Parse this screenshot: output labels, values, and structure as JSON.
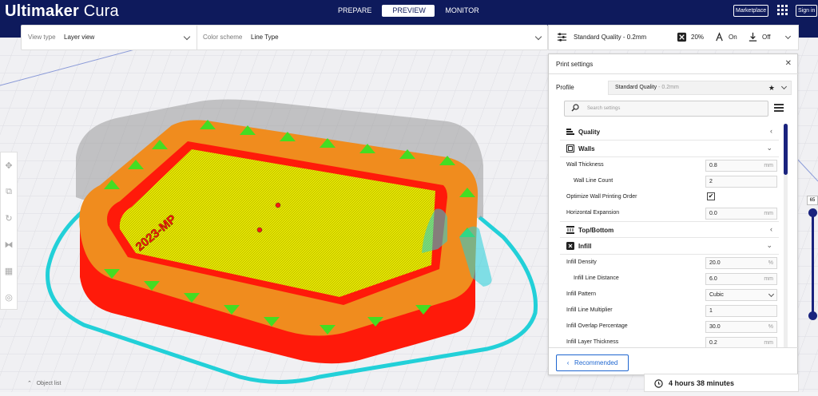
{
  "header": {
    "logo_bold": "Ultimaker",
    "logo_light": "Cura",
    "tabs": [
      {
        "label": "PREPARE"
      },
      {
        "label": "PREVIEW"
      },
      {
        "label": "MONITOR"
      }
    ],
    "marketplace": "Marketplace",
    "signin": "Sign in"
  },
  "toolbar": {
    "view_type_label": "View type",
    "view_type_value": "Layer view",
    "color_scheme_label": "Color scheme",
    "color_scheme_value": "Line Type"
  },
  "quality_bar": {
    "profile": "Standard Quality - 0.2mm",
    "infill": "20%",
    "support": "On",
    "adhesion": "Off"
  },
  "panel": {
    "title": "Print settings",
    "profile_label": "Profile",
    "profile_value": "Standard Quality",
    "profile_sub": " - 0.2mm",
    "search_placeholder": "Search settings",
    "categories": {
      "quality": "Quality",
      "walls": "Walls",
      "topbottom": "Top/Bottom",
      "infill": "Infill"
    },
    "settings": {
      "wall_thickness": {
        "label": "Wall Thickness",
        "value": "0.8",
        "unit": "mm"
      },
      "wall_line_count": {
        "label": "Wall Line Count",
        "value": "2"
      },
      "optimize_wall": {
        "label": "Optimize Wall Printing Order",
        "checked": "✔"
      },
      "horizontal_expansion": {
        "label": "Horizontal Expansion",
        "value": "0.0",
        "unit": "mm"
      },
      "infill_density": {
        "label": "Infill Density",
        "value": "20.0",
        "unit": "%"
      },
      "infill_line_distance": {
        "label": "Infill Line Distance",
        "value": "6.0",
        "unit": "mm"
      },
      "infill_pattern": {
        "label": "Infill Pattern",
        "value": "Cubic"
      },
      "infill_line_multiplier": {
        "label": "Infill Line Multiplier",
        "value": "1"
      },
      "infill_overlap": {
        "label": "Infill Overlap Percentage",
        "value": "30.0",
        "unit": "%"
      },
      "infill_layer_thickness": {
        "label": "Infill Layer Thickness",
        "value": "0.2",
        "unit": "mm"
      }
    },
    "recommended": "Recommended"
  },
  "print_time": "4 hours 38 minutes",
  "layer_number": "65",
  "object_list": "Object list",
  "model_text": "2023-MP",
  "colors": {
    "header_bg": "#0e1a5c",
    "accent": "#1e66d0",
    "wall_red": "#ff1a0a",
    "infill_yellow": "#e8e800",
    "skin_orange": "#f08c1e",
    "support_cyan": "#22d0d8"
  }
}
